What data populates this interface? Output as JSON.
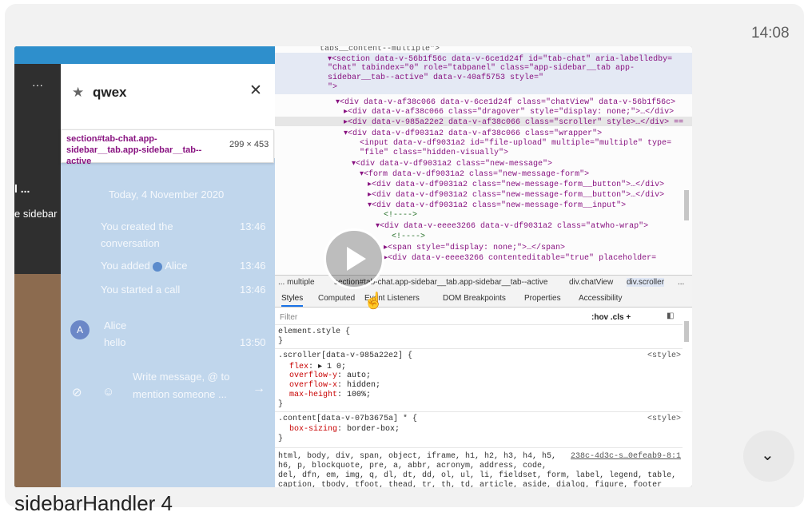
{
  "message": {
    "time": "14:08",
    "caption": "sidebarHandler 4"
  },
  "video": {
    "state": "paused",
    "play_icon": "play-icon",
    "scroll_button_icon": "chevron-down-icon"
  },
  "app": {
    "left_menu_dots": "···",
    "left_label_1": "l ...",
    "left_label_2": "e sidebar",
    "chat_title": "qwex",
    "inspector_selector": "section#tab-chat.app-sidebar__tab.app-sidebar__tab--active",
    "inspector_size": "299 × 453",
    "date_separator": "Today, 4 November 2020",
    "messages": [
      {
        "text": "You created the",
        "text2": "conversation",
        "time": "13:46"
      },
      {
        "text": "You added",
        "mention": "Alice",
        "time": "13:46"
      },
      {
        "text": "You started a call",
        "time": "13:46"
      }
    ],
    "alice": {
      "initial": "A",
      "name": "Alice",
      "text": "hello",
      "time": "13:50"
    },
    "composer_placeholder_1": "Write message, @ to",
    "composer_placeholder_2": "mention someone ..."
  },
  "devtools": {
    "elements_lines": [
      "tabs__content--multiple\">",
      "▾<section data-v-56b1f56c data-v-6ce1d24f id=\"tab-chat\" aria-labelledby=",
      "\"Chat\" tabindex=\"0\" role=\"tabpanel\" class=\"app-sidebar__tab app-",
      "sidebar__tab--active\" data-v-40af5753 style=\"",
      "\">",
      "▾<div data-v-af38c066 data-v-6ce1d24f class=\"chatView\" data-v-56b1f56c>",
      "▸<div data-v-af38c066 class=\"dragover\" style=\"display: none;\">…</div>",
      "▸<div data-v-985a22e2 data-v-af38c066 class=\"scroller\" style>…</div> ==",
      "▾<div data-v-df9031a2 data-v-af38c066 class=\"wrapper\">",
      "<input data-v-df9031a2 id=\"file-upload\" multiple=\"multiple\" type=",
      "\"file\" class=\"hidden-visually\">",
      "▾<div data-v-df9031a2 class=\"new-message\">",
      "▾<form data-v-df9031a2 class=\"new-message-form\">",
      "▸<div data-v-df9031a2 class=\"new-message-form__button\">…</div>",
      "▸<div data-v-df9031a2 class=\"new-message-form__button\">…</div>",
      "▾<div data-v-df9031a2 class=\"new-message-form__input\">",
      "<!---->",
      "▾<div data-v-eeee3266 data-v-df9031a2 class=\"atwho-wrap\">",
      "<!---->",
      "▸<span style=\"display: none;\">…</span>",
      "▸<div data-v-eeee3266 contenteditable=\"true\" placeholder="
    ],
    "breadcrumbs": [
      "... multiple",
      "section#tab-chat.app-sidebar__tab.app-sidebar__tab--active",
      "div.chatView",
      "div.scroller",
      "..."
    ],
    "tabs": [
      "Styles",
      "Computed",
      "Event Listeners",
      "DOM Breakpoints",
      "Properties",
      "Accessibility"
    ],
    "filter_placeholder": "Filter",
    "filter_right": ":hov  .cls  +",
    "rules": {
      "element_style": "element.style {",
      "close": "}",
      "scroller_selector": ".scroller[data-v-985a22e2] {",
      "scroller_source": "<style>",
      "scroller_props": [
        {
          "prop": "flex",
          "value": "▸ 1 0;"
        },
        {
          "prop": "overflow-y",
          "value": "auto;"
        },
        {
          "prop": "overflow-x",
          "value": "hidden;"
        },
        {
          "prop": "max-height",
          "value": "100%;"
        }
      ],
      "content_selector": ".content[data-v-07b3675a] * {",
      "content_source": "<style>",
      "content_props": [
        {
          "prop": "box-sizing",
          "value": "border-box;"
        }
      ],
      "reset_lines": [
        "html, body, div, span, object, iframe, h1, h2, h3, h4, h5,",
        "h6, p, blockquote, pre, a, abbr, acronym, address, code,",
        "del, dfn, em, img, q, dl, dt, dd, ol, ul, li, fieldset, form, label, legend, table,",
        "caption, tbody, tfoot, thead, tr, th, td, article, aside, dialog, figure, footer"
      ],
      "reset_source": "238c-4d3c-s…0efeab9-8:1"
    }
  }
}
